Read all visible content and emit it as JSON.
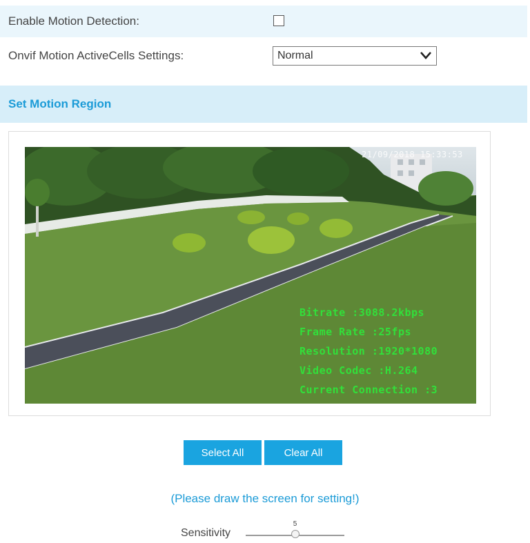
{
  "motion": {
    "enable_label": "Enable Motion Detection:",
    "enable_checked": false,
    "cells_label": "Onvif Motion ActiveCells Settings:",
    "cells_value": "Normal"
  },
  "region": {
    "title": "Set Motion Region"
  },
  "video": {
    "timestamp": "21/09/2018 15:33:53",
    "osd_lines": [
      "Bitrate :3088.2kbps",
      "Frame Rate :25fps",
      "Resolution :1920*1080",
      "Video Codec :H.264",
      "Current Connection :3"
    ]
  },
  "buttons": {
    "select_all": "Select All",
    "clear_all": "Clear All"
  },
  "hint": "(Please draw the screen for setting!)",
  "sensitivity": {
    "label": "Sensitivity",
    "value": "5",
    "fraction": 0.5
  },
  "colors": {
    "accent": "#1aa4e0",
    "header_bg": "#d7eef9",
    "osd_green": "#31e03a"
  }
}
